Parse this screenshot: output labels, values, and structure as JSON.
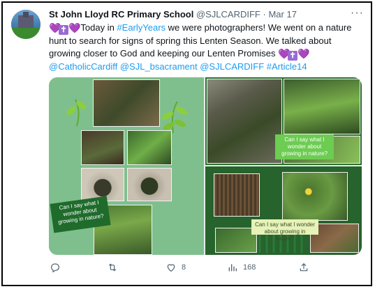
{
  "tweet": {
    "author_name": "St John Lloyd RC Primary School",
    "handle": "@SJLCARDIFF",
    "separator": "·",
    "date": "Mar 17",
    "text_1": " Today in ",
    "hashtag_1": "#EarlyYears",
    "text_2": " we were photographers! We went on a nature hunt to search for signs of spring this Lenten Season. We talked about growing closer to God and keeping our Lenten Promises ",
    "mention_1": "@CatholicCardiff",
    "mention_2": "@SJL_bsacrament",
    "mention_3": "@SJLCARDIFF",
    "hashtag_2": "#Article14",
    "emoji_heart": "💜",
    "emoji_cross": "✝",
    "more": "···"
  },
  "media": {
    "note_left": "Can I say what I wonder about growing in nature?",
    "note_top_right": "Can I say what I wonder about growing in nature?",
    "note_bottom_right": "Can I say what I wonder about growing in nature?"
  },
  "actions": {
    "replies": "",
    "retweets": "",
    "likes": "8",
    "views": "168"
  },
  "colors": {
    "link": "#1d9bf0",
    "text": "#0f1419",
    "muted": "#536471"
  }
}
